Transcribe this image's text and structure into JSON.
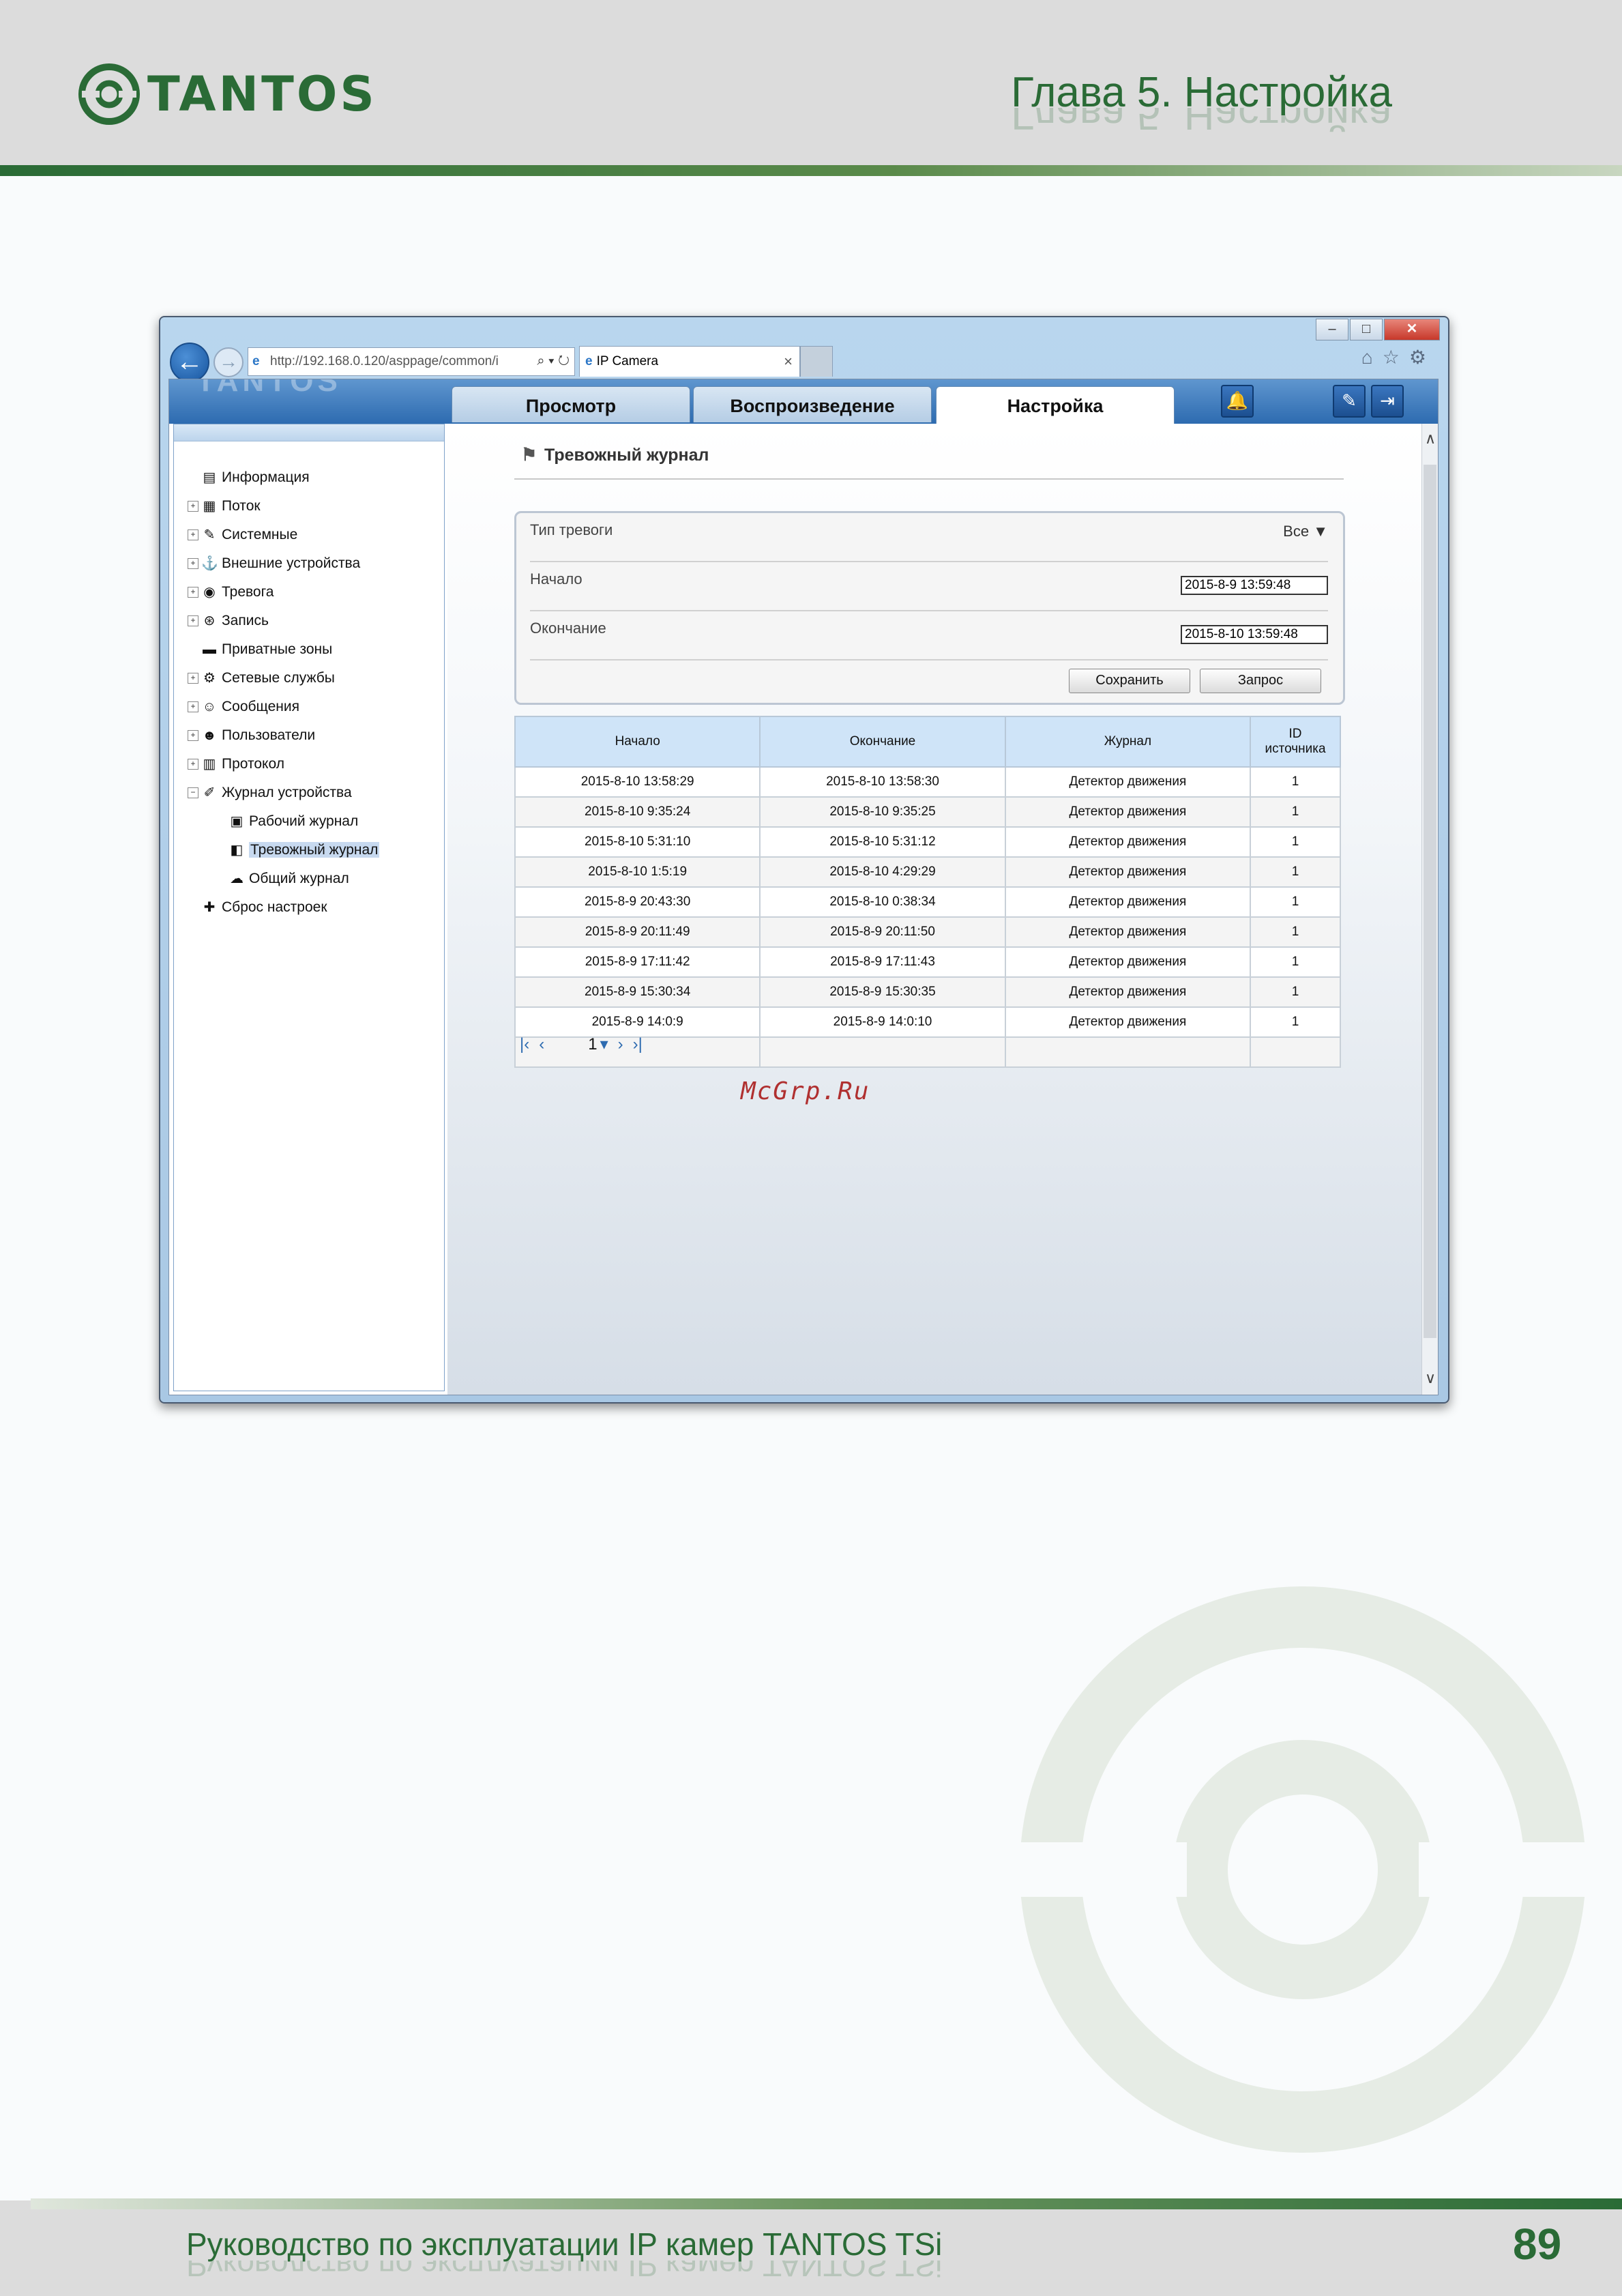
{
  "page": {
    "brand": "TANTOS",
    "chapter_title": "Глава 5. Настройка",
    "footer_text": "Руководство по эксплуатации IP камер TANTOS TSi",
    "page_number": "89",
    "watermark_label": "McGrp.Ru"
  },
  "browser": {
    "address": "http://192.168.0.120/asppage/common/i",
    "tab_title": "IP Camera",
    "tab_close": "×",
    "addr_tools": "⌕ ▾ ↻",
    "chrome_icons": "⌂☆⚙",
    "window_buttons": {
      "minimize": "–",
      "maximize": "□",
      "close": "✕"
    }
  },
  "app": {
    "logo_text": "TANTOS",
    "tabs": [
      {
        "label": "Просмотр"
      },
      {
        "label": "Воспроизведение"
      },
      {
        "label": "Настройка"
      }
    ],
    "active_tab": "Настройка",
    "header_icons": [
      {
        "icon": "bell-icon",
        "glyph": "🔔"
      },
      {
        "icon": "edit-icon",
        "glyph": "✎"
      },
      {
        "icon": "logout-icon",
        "glyph": "⇥"
      }
    ],
    "sidebar": {
      "items": [
        {
          "label": "Информация",
          "icon": "info-icon",
          "glyph": "▤",
          "expandable": false,
          "level": 0
        },
        {
          "label": "Поток",
          "icon": "stream-icon",
          "glyph": "▦",
          "expandable": true,
          "level": 0
        },
        {
          "label": "Системные",
          "icon": "system-icon",
          "glyph": "✎",
          "expandable": true,
          "level": 0
        },
        {
          "label": "Внешние устройства",
          "icon": "devices-icon",
          "glyph": "⚓",
          "expandable": true,
          "level": 0
        },
        {
          "label": "Тревога",
          "icon": "alarm-icon",
          "glyph": "◉",
          "expandable": true,
          "level": 0
        },
        {
          "label": "Запись",
          "icon": "record-icon",
          "glyph": "⊛",
          "expandable": true,
          "level": 0
        },
        {
          "label": "Приватные зоны",
          "icon": "privacy-icon",
          "glyph": "▬",
          "expandable": false,
          "level": 0
        },
        {
          "label": "Сетевые службы",
          "icon": "network-icon",
          "glyph": "⚙",
          "expandable": true,
          "level": 0
        },
        {
          "label": "Сообщения",
          "icon": "messages-icon",
          "glyph": "☺",
          "expandable": true,
          "level": 0
        },
        {
          "label": "Пользователи",
          "icon": "users-icon",
          "glyph": "☻",
          "expandable": true,
          "level": 0
        },
        {
          "label": "Протокол",
          "icon": "protocol-icon",
          "glyph": "▥",
          "expandable": true,
          "level": 0
        },
        {
          "label": "Журнал устройства",
          "icon": "device-log-icon",
          "glyph": "✐",
          "expandable": true,
          "expanded": true,
          "level": 0
        },
        {
          "label": "Рабочий журнал",
          "icon": "work-log-icon",
          "glyph": "▣",
          "expandable": false,
          "level": 1
        },
        {
          "label": "Тревожный журнал",
          "icon": "alarm-log-icon",
          "glyph": "◧",
          "expandable": false,
          "level": 1,
          "selected": true
        },
        {
          "label": "Общий журнал",
          "icon": "general-log-icon",
          "glyph": "☁",
          "expandable": false,
          "level": 1
        },
        {
          "label": "Сброс настроек",
          "icon": "reset-icon",
          "glyph": "✚",
          "expandable": false,
          "level": 0
        }
      ]
    },
    "section": {
      "title": "Тревожный журнал",
      "icon": "signpost-icon",
      "icon_glyph": "⚑"
    },
    "filter": {
      "alarm_type_label": "Тип тревоги",
      "alarm_type_value": "Все",
      "start_label": "Начало",
      "start_value": "2015-8-9 13:59:48",
      "end_label": "Окончание",
      "end_value": "2015-8-10 13:59:48",
      "save_label": "Сохранить",
      "query_label": "Запрос"
    },
    "table": {
      "headers": [
        "Начало",
        "Окончание",
        "Журнал",
        "ID источника"
      ],
      "header_id_line1": "ID",
      "header_id_line2": "источника",
      "rows": [
        [
          "2015-8-10 13:58:29",
          "2015-8-10 13:58:30",
          "Детектор движения",
          "1"
        ],
        [
          "2015-8-10 9:35:24",
          "2015-8-10 9:35:25",
          "Детектор движения",
          "1"
        ],
        [
          "2015-8-10 5:31:10",
          "2015-8-10 5:31:12",
          "Детектор движения",
          "1"
        ],
        [
          "2015-8-10 1:5:19",
          "2015-8-10 4:29:29",
          "Детектор движения",
          "1"
        ],
        [
          "2015-8-9 20:43:30",
          "2015-8-10 0:38:34",
          "Детектор движения",
          "1"
        ],
        [
          "2015-8-9 20:11:49",
          "2015-8-9 20:11:50",
          "Детектор движения",
          "1"
        ],
        [
          "2015-8-9 17:11:42",
          "2015-8-9 17:11:43",
          "Детектор движения",
          "1"
        ],
        [
          "2015-8-9 15:30:34",
          "2015-8-9 15:30:35",
          "Детектор движения",
          "1"
        ],
        [
          "2015-8-9 14:0:9",
          "2015-8-9 14:0:10",
          "Детектор движения",
          "1"
        ]
      ]
    },
    "pager": {
      "first": "|‹",
      "prev": "‹",
      "page": "1",
      "dropdown": "▾",
      "next": "›",
      "last": "›|"
    }
  }
}
